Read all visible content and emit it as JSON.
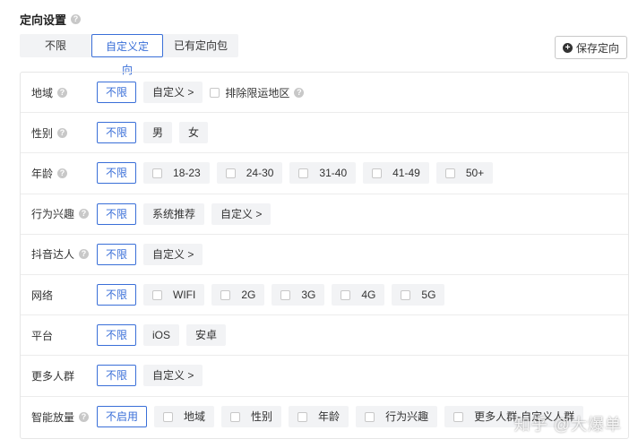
{
  "header": {
    "title": "定向设置",
    "help": "?"
  },
  "tabs": [
    {
      "label": "不限"
    },
    {
      "label": "自定义定向"
    },
    {
      "label": "已有定向包"
    }
  ],
  "save": {
    "icon": "+",
    "label": "保存定向"
  },
  "rows": [
    {
      "label": "地域",
      "help": "?",
      "unlimited": "不限",
      "custom": "自定义 >",
      "exclude": "排除限运地区",
      "exclude_help": "?"
    },
    {
      "label": "性别",
      "help": "?",
      "unlimited": "不限",
      "opts": [
        "男",
        "女"
      ]
    },
    {
      "label": "年龄",
      "help": "?",
      "unlimited": "不限",
      "opts": [
        "18-23",
        "24-30",
        "31-40",
        "41-49",
        "50+"
      ]
    },
    {
      "label": "行为兴趣",
      "help": "?",
      "unlimited": "不限",
      "opts": [
        "系统推荐",
        "自定义 >"
      ]
    },
    {
      "label": "抖音达人",
      "help": "?",
      "unlimited": "不限",
      "custom": "自定义 >"
    },
    {
      "label": "网络",
      "unlimited": "不限",
      "opts": [
        "WIFI",
        "2G",
        "3G",
        "4G",
        "5G"
      ]
    },
    {
      "label": "平台",
      "unlimited": "不限",
      "opts": [
        "iOS",
        "安卓"
      ]
    },
    {
      "label": "更多人群",
      "unlimited": "不限",
      "custom": "自定义 >"
    },
    {
      "label": "智能放量",
      "help": "?",
      "unlimited": "不启用",
      "opts": [
        "地域",
        "性别",
        "年龄",
        "行为兴趣",
        "更多人群-自定义人群"
      ]
    }
  ],
  "watermark": "知乎 @大爆单",
  "colors": {
    "accent": "#3a6fd8",
    "option_bg": "#f2f3f5"
  }
}
